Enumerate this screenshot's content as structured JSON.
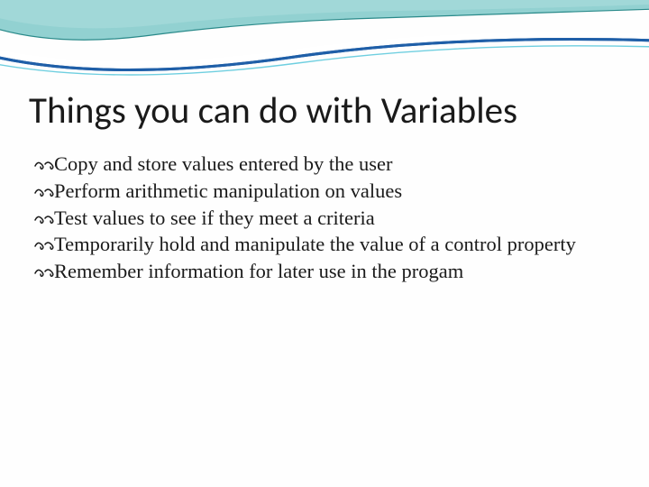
{
  "title": "Things you can do with Variables",
  "bullets": [
    "Copy and store values entered by the user",
    "Perform arithmetic manipulation on values",
    "Test values to see if they meet a criteria",
    "Temporarily hold and manipulate the value of a control property",
    "Remember information for later use in the progam"
  ]
}
